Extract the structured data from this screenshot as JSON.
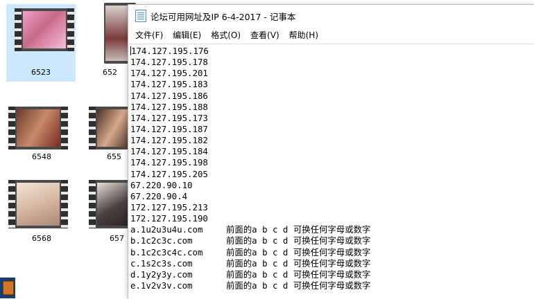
{
  "desktop": {
    "tiles": [
      {
        "label": "6523",
        "selected": true
      },
      {
        "label": "652"
      },
      {
        "label": "6548"
      },
      {
        "label": "655"
      },
      {
        "label": "6568"
      },
      {
        "label": "657"
      }
    ]
  },
  "notepad": {
    "title": "论坛可用网址及IP 6-4-2017 - 记事本",
    "menu": [
      "文件(F)",
      "编辑(E)",
      "格式(O)",
      "查看(V)",
      "帮助(H)"
    ],
    "ip_lines": [
      "174.127.195.176",
      "174.127.195.178",
      "174.127.195.201",
      "174.127.195.183",
      "174.127.195.186",
      "174.127.195.188",
      "174.127.195.173",
      "174.127.195.187",
      "174.127.195.182",
      "174.127.195.184",
      "174.127.195.198",
      "174.127.195.205",
      "67.220.90.10",
      "67.220.90.4",
      "172.127.195.213",
      "172.127.195.190"
    ],
    "domain_lines": [
      {
        "domain": "a.1u2u3u4u.com",
        "note": "前面的a b c d 可换任何字母或数字"
      },
      {
        "domain": "b.1c2c3c.com",
        "note": "前面的a b c d 可换任何字母或数字"
      },
      {
        "domain": "b.1c2c3c4c.com",
        "note": "前面的a b c d 可换任何字母或数字"
      },
      {
        "domain": "c.1s2c3s.com",
        "note": "前面的a b c d 可换任何字母或数字"
      },
      {
        "domain": "d.1y2y3y.com",
        "note": "前面的a b c d 可换任何字母或数字"
      },
      {
        "domain": "e.1v2v3v.com",
        "note": "前面的a b c d 可换任何字母或数字"
      }
    ]
  }
}
